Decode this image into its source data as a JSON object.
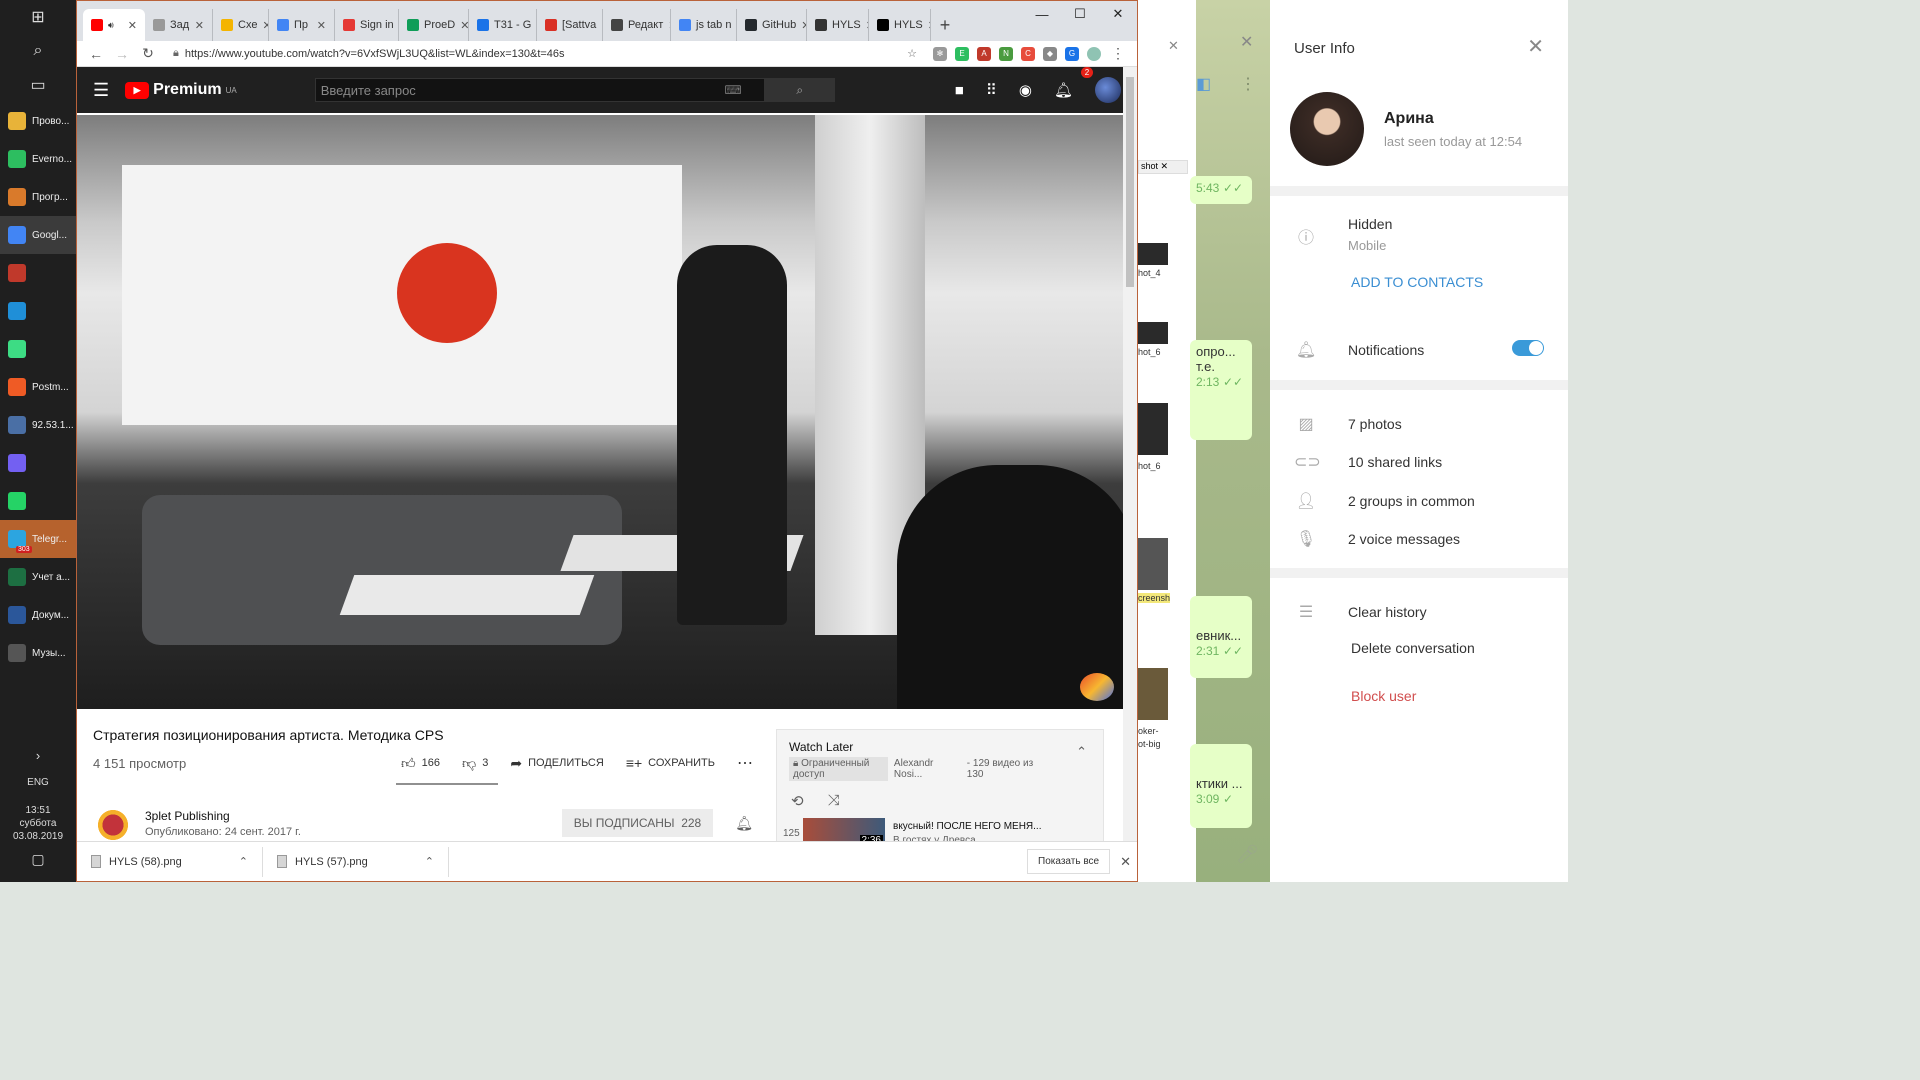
{
  "taskbar": {
    "apps": [
      {
        "label": "Прово...",
        "icon": "folder-icon",
        "color": "#e8b339"
      },
      {
        "label": "Everno...",
        "icon": "evernote-icon",
        "color": "#2dbe60"
      },
      {
        "label": "Прогр...",
        "icon": "program-icon",
        "color": "#d97a2b"
      },
      {
        "label": "Googl...",
        "icon": "chrome-icon",
        "color": "#4285f4"
      },
      {
        "label": "",
        "icon": "rm-icon",
        "color": "#c0392b"
      },
      {
        "label": "",
        "icon": "webstorm-icon",
        "color": "#1f8fd8"
      },
      {
        "label": "",
        "icon": "android-icon",
        "color": "#3ddc84"
      },
      {
        "label": "Postm...",
        "icon": "postman-icon",
        "color": "#ef5b25"
      },
      {
        "label": "92.53.1...",
        "icon": "remote-desktop-icon",
        "color": "#4a6fa5"
      },
      {
        "label": "",
        "icon": "viber-icon",
        "color": "#7360f2"
      },
      {
        "label": "",
        "icon": "whatsapp-icon",
        "color": "#25d366"
      },
      {
        "label": "Telegr...",
        "icon": "telegram-icon",
        "color": "#2ca5e0",
        "badge": "303"
      },
      {
        "label": "Учет а...",
        "icon": "excel-icon",
        "color": "#1d6f42"
      },
      {
        "label": "Докум...",
        "icon": "word-icon",
        "color": "#2b579a"
      },
      {
        "label": "Музы...",
        "icon": "music-icon",
        "color": "#555555"
      }
    ],
    "lang": "ENG",
    "time": "13:51",
    "day": "суббота",
    "date": "03.08.2019"
  },
  "chrome": {
    "tabs": [
      {
        "label": "",
        "color": "#ff0000",
        "active": true
      },
      {
        "label": "Зад",
        "color": "#999999"
      },
      {
        "label": "Схе",
        "color": "#f4b400"
      },
      {
        "label": "Пр",
        "color": "#4285f4"
      },
      {
        "label": "Sign in",
        "color": "#e53935"
      },
      {
        "label": "ProeD",
        "color": "#0f9d58"
      },
      {
        "label": "T31 - G",
        "color": "#1a73e8"
      },
      {
        "label": "[Sattva",
        "color": "#d93025"
      },
      {
        "label": "Редакт",
        "color": "#444444"
      },
      {
        "label": "js tab n",
        "color": "#4285f4"
      },
      {
        "label": "GitHub",
        "color": "#24292e"
      },
      {
        "label": "HYLS",
        "color": "#333333"
      },
      {
        "label": "HYLS",
        "color": "#000000"
      }
    ],
    "url": "https://www.youtube.com/watch?v=6VxfSWjL3UQ&list=WL&index=130&t=46s",
    "downloads": [
      {
        "name": "HYLS (58).png"
      },
      {
        "name": "HYLS (57).png"
      }
    ],
    "show_all": "Показать все"
  },
  "youtube": {
    "logo_text": "Premium",
    "region": "UA",
    "search_placeholder": "Введите запрос",
    "notif_count": "2",
    "video_title": "Стратегия позиционирования артиста. Методика CPS",
    "views": "4 151 просмотр",
    "likes": "166",
    "dislikes": "3",
    "share": "ПОДЕЛИТЬСЯ",
    "save": "СОХРАНИТЬ",
    "channel": "3plet Publishing",
    "published": "Опубликовано: 24 сент. 2017 г.",
    "subscribed": "ВЫ ПОДПИСАНЫ",
    "subs_count": "228",
    "playlist": {
      "title": "Watch Later",
      "privacy": "Ограниченный доступ",
      "owner": "Alexandr Nosi...",
      "position": "- 129 видео из 130",
      "item_index": "125",
      "item_title": "вкусный! ПОСЛЕ НЕГО МЕНЯ...",
      "item_channel": "В гостях у Древса",
      "item_duration": "2:36"
    }
  },
  "behind": {
    "tab_label": "shot",
    "thumbs": [
      "hot_4",
      "hot_6",
      "hot_6",
      "creensh",
      "oker-",
      "ot-big"
    ],
    "bubbles": [
      {
        "text": "",
        "time": "5:43"
      },
      {
        "text": "опро... т.е.",
        "time": "2:13"
      },
      {
        "text": "евник...",
        "time": "2:31"
      },
      {
        "text": "ктики ...",
        "time": "3:09"
      }
    ]
  },
  "telegram_info": {
    "header": "User Info",
    "name": "Арина",
    "last_seen": "last seen today at 12:54",
    "phone_label": "Hidden",
    "phone_sub": "Mobile",
    "add_contacts": "ADD TO CONTACTS",
    "notifications": "Notifications",
    "notifications_on": true,
    "photos": "7 photos",
    "links": "10 shared links",
    "groups": "2 groups in common",
    "voice": "2 voice messages",
    "clear_history": "Clear history",
    "delete_conversation": "Delete conversation",
    "block_user": "Block user"
  }
}
